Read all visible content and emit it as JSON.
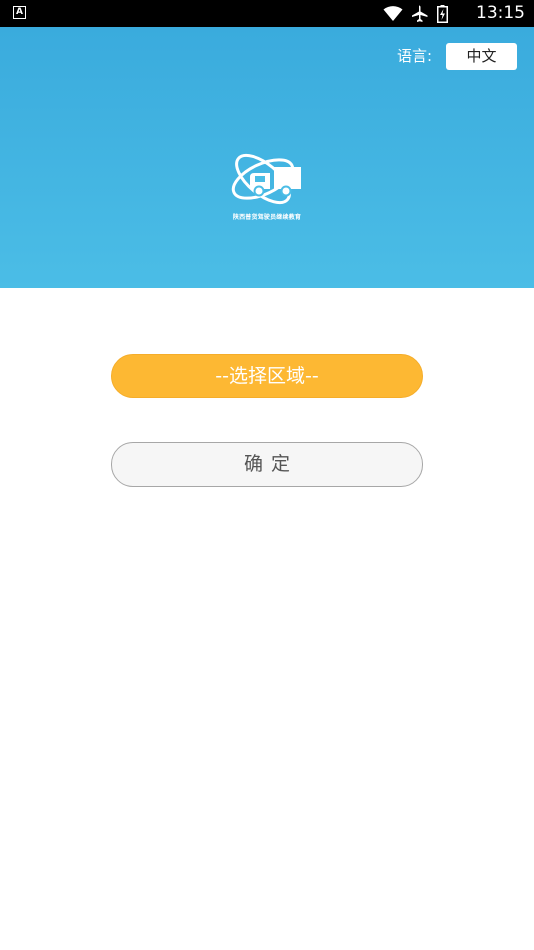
{
  "status_bar": {
    "notification_icon": "A",
    "time": "13:15",
    "icons": [
      "wifi-icon",
      "airplane-mode-icon",
      "battery-icon"
    ]
  },
  "header": {
    "language_label": "语言:",
    "language_value": "中文",
    "logo_icon": "truck-orbit-logo",
    "logo_text": "陕西普货驾驶员继续教育",
    "colors": {
      "gradient_top": "#3aabdd",
      "gradient_bottom": "#4bbde6"
    }
  },
  "main": {
    "region_button_label": "--选择区域--",
    "confirm_button_label": "确定",
    "colors": {
      "region_button": "#fdb833",
      "confirm_button_bg": "#f6f6f6",
      "confirm_button_border": "#a7a7a7"
    }
  }
}
